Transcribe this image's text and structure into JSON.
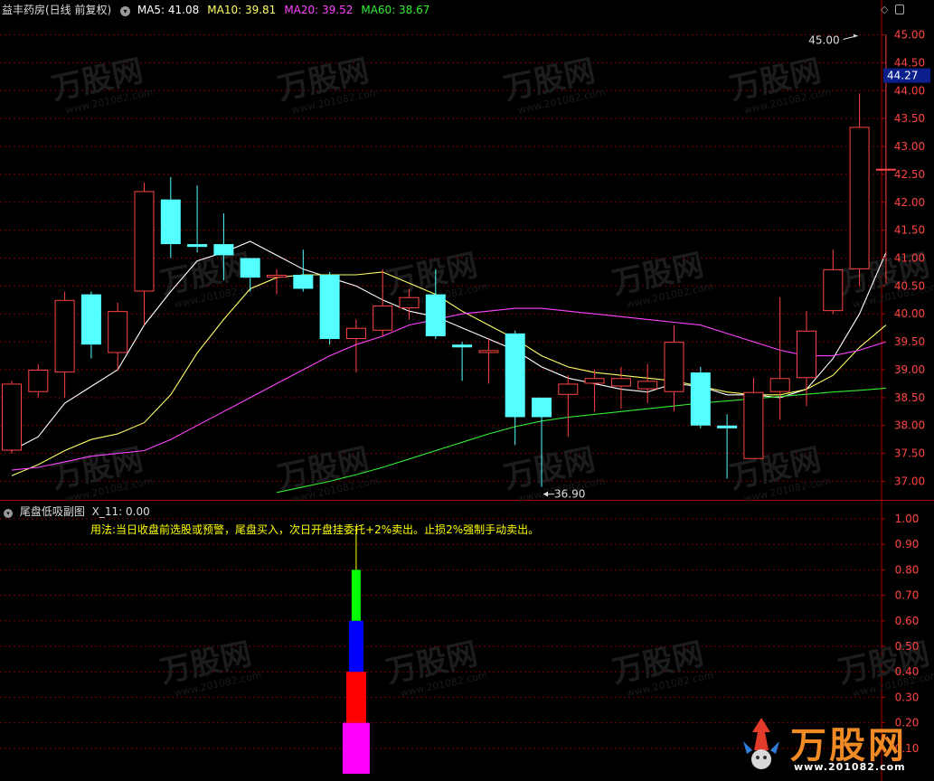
{
  "header": {
    "stock_label": "益丰药房(日线 前复权)",
    "ma_items": [
      {
        "label": "MA5: 41.08",
        "color": "#ffffff"
      },
      {
        "label": "MA10: 39.81",
        "color": "#ffff66"
      },
      {
        "label": "MA20: 39.52",
        "color": "#ff44ff"
      },
      {
        "label": "MA60: 38.67",
        "color": "#33ee33"
      }
    ]
  },
  "sub_header": {
    "indicator_label": "尾盘低吸副图",
    "value_label": "X_11: 0.00",
    "usage_text": "用法:当日收盘前选股或预警，尾盘买入，次日开盘挂委托+2%卖出。止损2%强制手动卖出。"
  },
  "watermark": {
    "brand": "万股网",
    "url": "www.201082.com"
  },
  "chart_data": [
    {
      "type": "candlestick",
      "ylim": [
        36.7,
        45.3
      ],
      "y_ticks": [
        "45.00",
        "44.50",
        "44.00",
        "43.50",
        "43.00",
        "42.50",
        "42.00",
        "41.50",
        "41.00",
        "40.50",
        "40.00",
        "39.50",
        "39.00",
        "38.50",
        "38.00",
        "37.50",
        "37.00"
      ],
      "y_tick_values": [
        45.0,
        44.5,
        44.0,
        43.5,
        43.0,
        42.5,
        42.0,
        41.5,
        41.0,
        40.5,
        40.0,
        39.5,
        39.0,
        38.5,
        38.0,
        37.5,
        37.0
      ],
      "current_price": "44.27",
      "current_price_value": 44.27,
      "annotations": [
        {
          "text": "45.00",
          "value": 45.0,
          "bar": 32
        },
        {
          "text": "36.90",
          "value": 36.9,
          "bar": 20
        }
      ],
      "up_color": "#ff4444",
      "down_color": "#54ffff",
      "candles": [
        {
          "o": 37.55,
          "h": 38.8,
          "l": 37.5,
          "c": 38.75
        },
        {
          "o": 38.6,
          "h": 39.1,
          "l": 38.5,
          "c": 39.0
        },
        {
          "o": 38.95,
          "h": 40.4,
          "l": 38.5,
          "c": 40.25
        },
        {
          "o": 40.35,
          "h": 40.4,
          "l": 39.2,
          "c": 39.45
        },
        {
          "o": 39.3,
          "h": 40.2,
          "l": 39.0,
          "c": 40.05
        },
        {
          "o": 40.4,
          "h": 42.35,
          "l": 39.8,
          "c": 42.2
        },
        {
          "o": 42.05,
          "h": 42.45,
          "l": 41.0,
          "c": 41.25
        },
        {
          "o": 41.25,
          "h": 42.3,
          "l": 41.1,
          "c": 41.2
        },
        {
          "o": 41.25,
          "h": 41.8,
          "l": 40.6,
          "c": 41.05
        },
        {
          "o": 41.0,
          "h": 41.0,
          "l": 40.4,
          "c": 40.65
        },
        {
          "o": 40.65,
          "h": 40.8,
          "l": 40.35,
          "c": 40.7
        },
        {
          "o": 40.7,
          "h": 41.15,
          "l": 40.4,
          "c": 40.45
        },
        {
          "o": 40.7,
          "h": 40.75,
          "l": 39.45,
          "c": 39.55
        },
        {
          "o": 39.55,
          "h": 39.9,
          "l": 38.95,
          "c": 39.75
        },
        {
          "o": 39.7,
          "h": 40.8,
          "l": 39.6,
          "c": 40.15
        },
        {
          "o": 40.1,
          "h": 40.45,
          "l": 39.9,
          "c": 40.3
        },
        {
          "o": 40.35,
          "h": 40.8,
          "l": 39.55,
          "c": 39.6
        },
        {
          "o": 39.45,
          "h": 39.5,
          "l": 38.8,
          "c": 39.4
        },
        {
          "o": 39.3,
          "h": 39.55,
          "l": 38.75,
          "c": 39.35
        },
        {
          "o": 39.65,
          "h": 39.7,
          "l": 37.65,
          "c": 38.15
        },
        {
          "o": 38.5,
          "h": 38.5,
          "l": 36.9,
          "c": 38.15
        },
        {
          "o": 38.55,
          "h": 38.9,
          "l": 37.8,
          "c": 38.75
        },
        {
          "o": 38.75,
          "h": 39.0,
          "l": 38.25,
          "c": 38.85
        },
        {
          "o": 38.7,
          "h": 39.05,
          "l": 38.3,
          "c": 38.85
        },
        {
          "o": 38.65,
          "h": 39.1,
          "l": 38.4,
          "c": 38.8
        },
        {
          "o": 38.6,
          "h": 39.8,
          "l": 38.25,
          "c": 39.5
        },
        {
          "o": 38.95,
          "h": 39.05,
          "l": 37.95,
          "c": 38.0
        },
        {
          "o": 38.0,
          "h": 38.2,
          "l": 37.05,
          "c": 37.95
        },
        {
          "o": 37.4,
          "h": 38.85,
          "l": 37.4,
          "c": 38.6
        },
        {
          "o": 38.6,
          "h": 40.3,
          "l": 38.1,
          "c": 38.85
        },
        {
          "o": 38.85,
          "h": 40.05,
          "l": 38.35,
          "c": 39.7
        },
        {
          "o": 40.05,
          "h": 41.15,
          "l": 40.0,
          "c": 40.8
        },
        {
          "o": 40.8,
          "h": 43.95,
          "l": 40.5,
          "c": 43.35
        },
        {
          "o": 42.6,
          "h": 45.0,
          "l": 40.55,
          "c": 42.6
        }
      ],
      "series": [
        {
          "name": "MA5",
          "color": "#ffffff",
          "values": [
            37.55,
            37.8,
            38.4,
            38.7,
            39.0,
            39.8,
            40.4,
            40.95,
            41.1,
            41.3,
            41.05,
            40.8,
            40.65,
            40.5,
            40.25,
            40.05,
            39.95,
            39.75,
            39.55,
            39.35,
            39.05,
            38.85,
            38.75,
            38.65,
            38.6,
            38.75,
            38.7,
            38.55,
            38.55,
            38.5,
            38.65,
            39.2,
            40.0,
            41.1
          ]
        },
        {
          "name": "MA10",
          "color": "#ffff66",
          "values": [
            37.1,
            37.3,
            37.55,
            37.75,
            37.85,
            38.05,
            38.55,
            39.3,
            39.9,
            40.45,
            40.65,
            40.7,
            40.7,
            40.7,
            40.75,
            40.55,
            40.35,
            40.05,
            39.8,
            39.55,
            39.25,
            39.05,
            38.95,
            38.9,
            38.85,
            38.8,
            38.7,
            38.6,
            38.55,
            38.55,
            38.65,
            38.9,
            39.4,
            39.8
          ]
        },
        {
          "name": "MA20",
          "color": "#ff44ff",
          "values": [
            37.2,
            37.25,
            37.35,
            37.45,
            37.5,
            37.55,
            37.75,
            38.0,
            38.25,
            38.5,
            38.75,
            39.0,
            39.25,
            39.45,
            39.6,
            39.8,
            39.9,
            40.0,
            40.05,
            40.1,
            40.1,
            40.05,
            40.0,
            39.95,
            39.9,
            39.85,
            39.8,
            39.65,
            39.5,
            39.35,
            39.25,
            39.25,
            39.35,
            39.5
          ]
        },
        {
          "name": "MA60",
          "color": "#33ee33",
          "start": 10,
          "values": [
            36.8,
            36.9,
            37.0,
            37.12,
            37.25,
            37.4,
            37.55,
            37.7,
            37.85,
            37.98,
            38.08,
            38.15,
            38.2,
            38.25,
            38.3,
            38.35,
            38.4,
            38.44,
            38.48,
            38.52,
            38.56,
            38.6,
            38.63,
            38.67
          ]
        }
      ]
    },
    {
      "type": "bar",
      "ylim": [
        0,
        1.05
      ],
      "y_ticks": [
        "1.00",
        "0.90",
        "0.80",
        "0.70",
        "0.60",
        "0.50",
        "0.40",
        "0.30",
        "0.20",
        "0.10"
      ],
      "y_tick_values": [
        1.0,
        0.9,
        0.8,
        0.7,
        0.6,
        0.5,
        0.4,
        0.3,
        0.2,
        0.1
      ],
      "stacked_column": {
        "bar": 13,
        "line_top": 0.97,
        "segments": [
          {
            "from": 0.0,
            "to": 0.2,
            "color": "#ff00ff"
          },
          {
            "from": 0.2,
            "to": 0.4,
            "color": "#ff0000"
          },
          {
            "from": 0.4,
            "to": 0.6,
            "color": "#0000ff"
          },
          {
            "from": 0.6,
            "to": 0.8,
            "color": "#00ff00"
          }
        ],
        "line_color": "#ffff00"
      }
    }
  ]
}
